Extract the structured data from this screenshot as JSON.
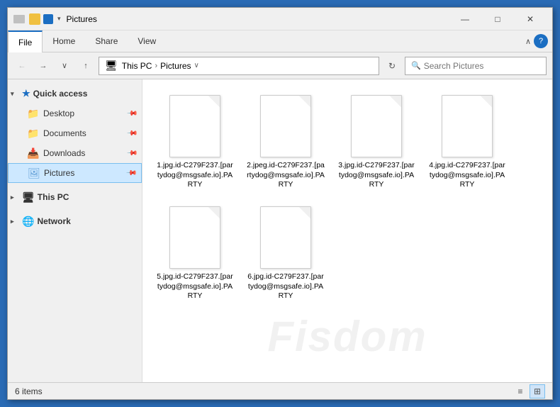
{
  "window": {
    "title": "Pictures",
    "titlebar_icons": [
      "folder",
      "pin"
    ],
    "controls": {
      "minimize": "—",
      "maximize": "□",
      "close": "✕"
    }
  },
  "ribbon": {
    "tabs": [
      "File",
      "Home",
      "Share",
      "View"
    ]
  },
  "addressbar": {
    "back": "←",
    "forward": "→",
    "recent": "∨",
    "up": "↑",
    "path_segments": [
      "This PC",
      "Pictures"
    ],
    "dropdown": "∨",
    "refresh": "↻",
    "search_placeholder": "Search Pictures"
  },
  "sidebar": {
    "quick_access_label": "Quick access",
    "items": [
      {
        "id": "desktop",
        "label": "Desktop",
        "icon": "📁",
        "pinned": true
      },
      {
        "id": "documents",
        "label": "Documents",
        "icon": "📁",
        "pinned": true
      },
      {
        "id": "downloads",
        "label": "Downloads",
        "icon": "📁",
        "pinned": true
      },
      {
        "id": "pictures",
        "label": "Pictures",
        "icon": "📁",
        "pinned": true,
        "active": true
      }
    ],
    "thispc_label": "This PC",
    "network_label": "Network"
  },
  "content": {
    "watermark": "Fisdom",
    "files": [
      {
        "id": "file1",
        "name": "1.jpg.id-C279F237.[partydog@msgsafe.io].PARTY"
      },
      {
        "id": "file2",
        "name": "2.jpeg.id-C279F237.[partydog@msgsafe.io].PARTY"
      },
      {
        "id": "file3",
        "name": "3.jpg.id-C279F237.[partydog@msgsafe.io].PARTY"
      },
      {
        "id": "file4",
        "name": "4.jpg.id-C279F237.[partydog@msgsafe.io].PARTY"
      },
      {
        "id": "file5",
        "name": "5.jpg.id-C279F237.[partydog@msgsafe.io].PARTY"
      },
      {
        "id": "file6",
        "name": "6.jpg.id-C279F237.[partydog@msgsafe.io].PARTY"
      }
    ]
  },
  "statusbar": {
    "count_label": "6 items",
    "view_icons": [
      "≡",
      "⊞"
    ]
  }
}
